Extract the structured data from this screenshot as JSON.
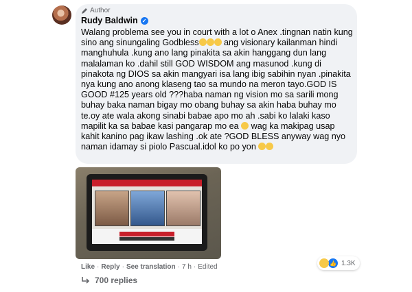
{
  "comment": {
    "author_badge": "Author",
    "name": "Rudy Baldwin",
    "text_parts": [
      "Walang problema see you in court with a lot o Anex .tingnan natin kung sino ang sinungaling Godbless",
      " ang visionary kailanman hindi manghuhula .kung ano lang pinakita sa akin hanggang dun lang malalaman ko .dahil still GOD WISDOM ang masunod .kung di pinakota ng DIOS sa akin mangyari isa lang ibig sabihin nyan .pinakita nya kung ano anong klaseng tao sa mundo na meron tayo.GOD IS GOOD #125 years old ???haba naman ng vision mo sa sarili mong buhay baka naman bigay mo obang buhay sa akin haba buhay mo te.oy ate wala akong sinabi babae apo mo ah .sabi ko lalaki kaso mapilit ka sa babae kasi pangarap mo ea",
      " wag ka makipag usap kahit kanino pag ikaw lashing .ok ate ?GOD BLESS anyway wag nyo naman idamay si piolo Pascual.idol ko po yon"
    ]
  },
  "actions": {
    "like": "Like",
    "reply": "Reply",
    "see_translation": "See translation",
    "time": "7 h",
    "edited": "Edited",
    "sep": "·"
  },
  "reactions": {
    "count": "1.3K"
  },
  "replies": {
    "label": "700 replies"
  },
  "colors": {
    "bubble": "#f0f2f5",
    "link_gray": "#65676b",
    "fb_blue": "#1877f2"
  }
}
